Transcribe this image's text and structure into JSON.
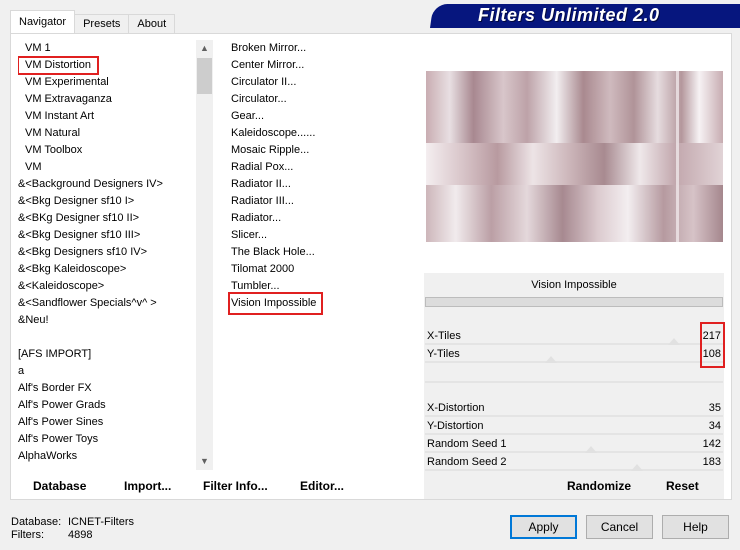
{
  "title": "Filters Unlimited 2.0",
  "tabs": [
    "Navigator",
    "Presets",
    "About"
  ],
  "categories": [
    "VM 1",
    "VM Distortion",
    "VM Experimental",
    "VM Extravaganza",
    "VM Instant Art",
    "VM Natural",
    "VM Toolbox",
    "VM",
    "&<Background Designers IV>",
    "&<Bkg Designer sf10 I>",
    "&<BKg Designer sf10 II>",
    "&<Bkg Designer sf10 III>",
    "&<Bkg Designers sf10 IV>",
    "&<Bkg Kaleidoscope>",
    "&<Kaleidoscope>",
    "&<Sandflower Specials^v^ >",
    "&Neu!",
    "",
    "[AFS IMPORT]",
    "a",
    "Alf's Border FX",
    "Alf's Power Grads",
    "Alf's Power Sines",
    "Alf's Power Toys",
    "AlphaWorks"
  ],
  "filters": [
    "Broken Mirror...",
    "Center Mirror...",
    "Circulator II...",
    "Circulator...",
    "Gear...",
    "Kaleidoscope......",
    "Mosaic Ripple...",
    "Radial Pox...",
    "Radiator II...",
    "Radiator III...",
    "Radiator...",
    "Slicer...",
    "The Black Hole...",
    "Tilomat 2000",
    "Tumbler...",
    "Vision Impossible"
  ],
  "selected_filter": "Vision Impossible",
  "params": {
    "x_tiles": {
      "label": "X-Tiles",
      "value": "217",
      "level": 0.85
    },
    "y_tiles": {
      "label": "Y-Tiles",
      "value": "108",
      "level": 0.42
    },
    "x_distortion": {
      "label": "X-Distortion",
      "value": "35",
      "level": 0.14
    },
    "y_distortion": {
      "label": "Y-Distortion",
      "value": "34",
      "level": 0.13
    },
    "random_seed_1": {
      "label": "Random Seed 1",
      "value": "142",
      "level": 0.56
    },
    "random_seed_2": {
      "label": "Random Seed 2",
      "value": "183",
      "level": 0.72
    }
  },
  "buttons": {
    "database": "Database",
    "import": "Import...",
    "filter_info": "Filter Info...",
    "editor": "Editor...",
    "randomize": "Randomize",
    "reset": "Reset",
    "apply": "Apply",
    "cancel": "Cancel",
    "help": "Help"
  },
  "status": {
    "database_label": "Database:",
    "database_value": "ICNET-Filters",
    "filters_label": "Filters:",
    "filters_value": "4898"
  },
  "colors": {
    "title_banner": "#06167e",
    "highlight": "#e02020",
    "preview_tone": "#b89aa0"
  }
}
